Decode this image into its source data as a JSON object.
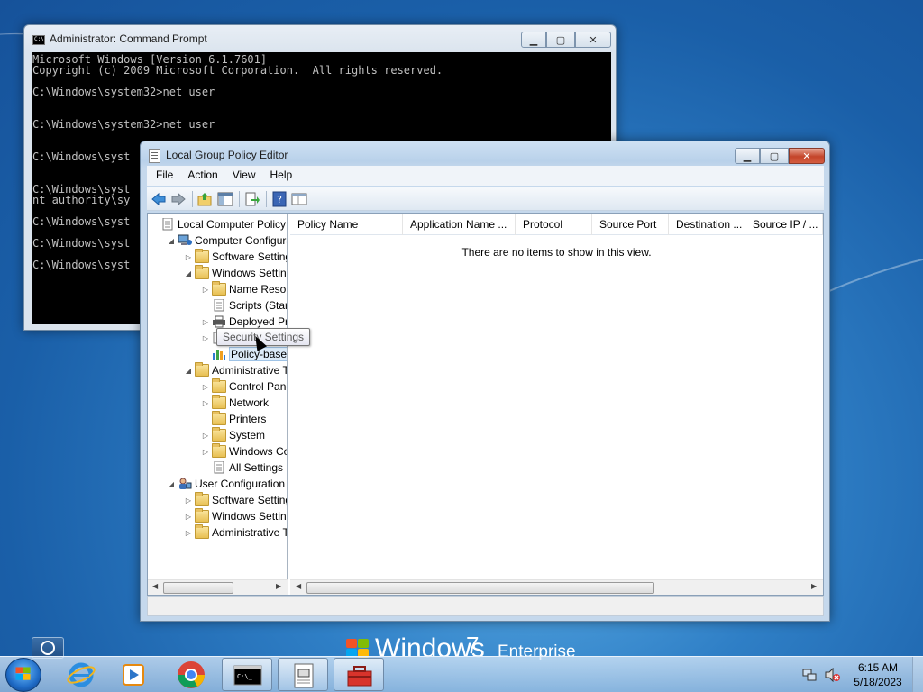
{
  "desktop": {
    "brand_windows": "Windows",
    "brand_version": "7",
    "brand_edition": "Enterprise"
  },
  "cmd": {
    "title": "Administrator: Command Prompt",
    "lines": [
      "Microsoft Windows [Version 6.1.7601]",
      "Copyright (c) 2009 Microsoft Corporation.  All rights reserved.",
      "",
      "C:\\Windows\\system32>net user",
      "",
      "",
      "C:\\Windows\\system32>net user",
      "",
      "",
      "C:\\Windows\\syst",
      "",
      "",
      "C:\\Windows\\syst",
      "nt authority\\sy",
      "",
      "C:\\Windows\\syst",
      "",
      "C:\\Windows\\syst",
      "",
      "C:\\Windows\\syst"
    ]
  },
  "gpedit": {
    "title": "Local Group Policy Editor",
    "menu": [
      "File",
      "Action",
      "View",
      "Help"
    ],
    "tree": [
      {
        "label": "Local Computer Policy",
        "indent": 0,
        "exp": "",
        "icon": "doc"
      },
      {
        "label": "Computer Configura",
        "indent": 1,
        "exp": "◢",
        "icon": "computer"
      },
      {
        "label": "Software Settings",
        "indent": 2,
        "exp": "▷",
        "icon": "folder"
      },
      {
        "label": "Windows Setting",
        "indent": 2,
        "exp": "◢",
        "icon": "folder"
      },
      {
        "label": "Name Resolu",
        "indent": 3,
        "exp": "▷",
        "icon": "folder"
      },
      {
        "label": "Scripts (Startu",
        "indent": 3,
        "exp": "",
        "icon": "doc"
      },
      {
        "label": "Deployed Prir",
        "indent": 3,
        "exp": "▷",
        "icon": "printer"
      },
      {
        "label": "Security Settings",
        "indent": 3,
        "exp": "▷",
        "icon": "security"
      },
      {
        "label": "Policy-based",
        "indent": 3,
        "exp": "",
        "icon": "chart",
        "selected": true
      },
      {
        "label": "Administrative Te",
        "indent": 2,
        "exp": "◢",
        "icon": "folder"
      },
      {
        "label": "Control Panel",
        "indent": 3,
        "exp": "▷",
        "icon": "folder"
      },
      {
        "label": "Network",
        "indent": 3,
        "exp": "▷",
        "icon": "folder"
      },
      {
        "label": "Printers",
        "indent": 3,
        "exp": "",
        "icon": "folder"
      },
      {
        "label": "System",
        "indent": 3,
        "exp": "▷",
        "icon": "folder"
      },
      {
        "label": "Windows Cor",
        "indent": 3,
        "exp": "▷",
        "icon": "folder"
      },
      {
        "label": "All Settings",
        "indent": 3,
        "exp": "",
        "icon": "doc"
      },
      {
        "label": "User Configuration",
        "indent": 1,
        "exp": "◢",
        "icon": "user"
      },
      {
        "label": "Software Settings",
        "indent": 2,
        "exp": "▷",
        "icon": "folder"
      },
      {
        "label": "Windows Setting",
        "indent": 2,
        "exp": "▷",
        "icon": "folder"
      },
      {
        "label": "Administrative Te",
        "indent": 2,
        "exp": "▷",
        "icon": "folder"
      }
    ],
    "columns": [
      "Policy Name",
      "Application Name ...",
      "Protocol",
      "Source Port",
      "Destination ...",
      "Source IP / ..."
    ],
    "empty_message": "There are no items to show in this view.",
    "tooltip": "Security Settings"
  },
  "taskbar": {
    "time": "6:15 AM",
    "date": "5/18/2023"
  }
}
